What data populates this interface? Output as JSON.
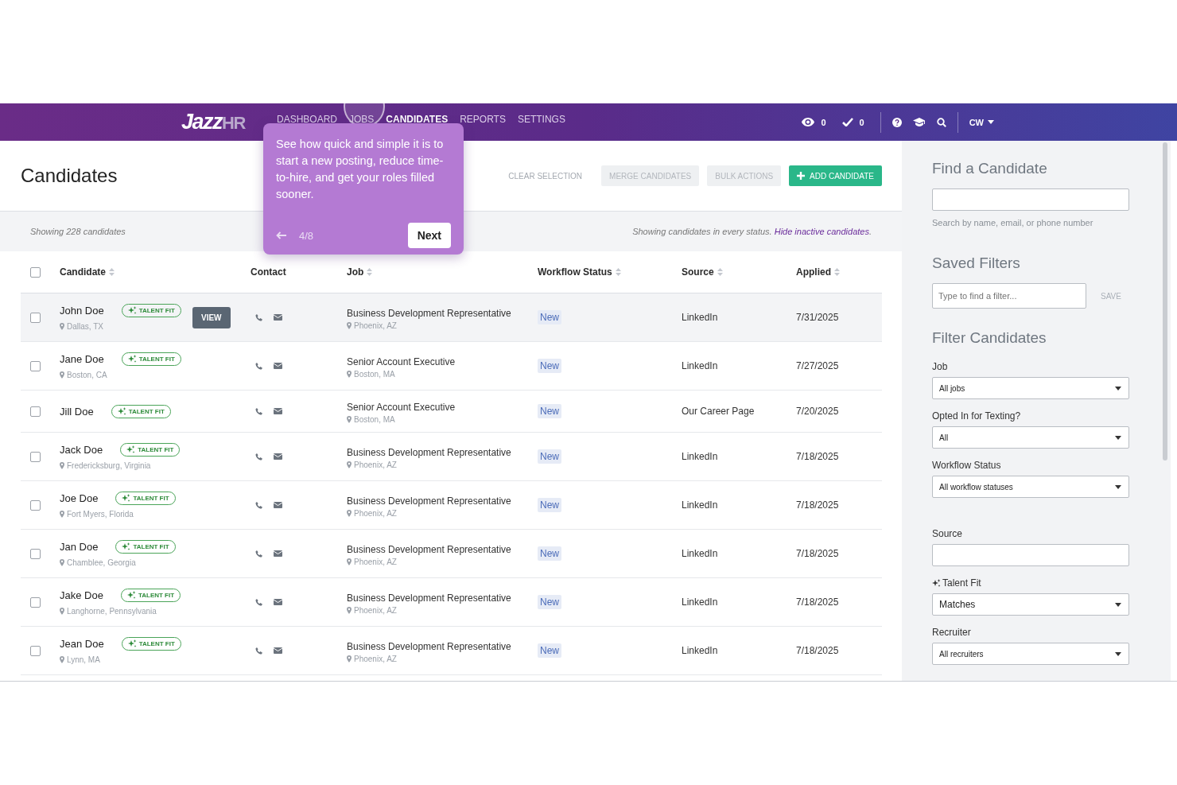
{
  "header": {
    "logo_main": "Jazz",
    "logo_accent": "HR",
    "nav": [
      {
        "label": "DASHBOARD",
        "selected": false
      },
      {
        "label": "JOBS",
        "selected": false
      },
      {
        "label": "CANDIDATES",
        "selected": true
      },
      {
        "label": "REPORTS",
        "selected": false
      },
      {
        "label": "SETTINGS",
        "selected": false
      }
    ],
    "stats": [
      {
        "kind": "views",
        "value": "0"
      },
      {
        "kind": "checks",
        "value": "0"
      }
    ],
    "user": "CW"
  },
  "tour": {
    "text": "See how quick and simple it is to start a new posting, reduce time-to-hire, and get your roles filled sooner.",
    "step": "4/8",
    "next": "Next"
  },
  "page": {
    "title": "Candidates",
    "actions": [
      {
        "label": "CLEAR SELECTION",
        "kind": "link"
      },
      {
        "label": "MERGE CANDIDATES",
        "kind": "disabled"
      },
      {
        "label": "BULK ACTIONS",
        "kind": "disabled"
      },
      {
        "label": "ADD CANDIDATE",
        "kind": "primary"
      }
    ]
  },
  "summary": {
    "count_text": "Showing 228 candidates",
    "status_text": "Showing candidates in every status.",
    "link": "Hide inactive candidates",
    "after": "."
  },
  "table": {
    "all_checked": false,
    "columns": [
      {
        "label": "Candidate",
        "sortable": true
      },
      {
        "label": "Contact",
        "sortable": false
      },
      {
        "label": "Job",
        "sortable": true
      },
      {
        "label": "Workflow Status",
        "sortable": true
      },
      {
        "label": "Source",
        "sortable": true
      },
      {
        "label": "Applied",
        "sortable": true
      }
    ],
    "rows": [
      {
        "name": "John Doe",
        "badge": "TALENT FIT",
        "location": "Dallas, TX",
        "hovered": true,
        "action": "VIEW",
        "job": "Business Development Representative",
        "job_location": "Phoenix, AZ",
        "status": "New",
        "source": "LinkedIn",
        "applied": "7/31/2025",
        "checked": false
      },
      {
        "name": "Jane Doe",
        "badge": "TALENT FIT",
        "location": "Boston, CA",
        "hovered": false,
        "job": "Senior Account Executive",
        "job_location": "Boston, MA",
        "status": "New",
        "source": "LinkedIn",
        "applied": "7/27/2025",
        "checked": false
      },
      {
        "name": "Jill Doe",
        "badge": "TALENT FIT",
        "hovered": false,
        "job": "Senior Account Executive",
        "job_location": "Boston, MA",
        "status": "New",
        "source": "Our Career Page",
        "applied": "7/20/2025",
        "checked": false
      },
      {
        "name": "Jack Doe",
        "badge": "TALENT FIT",
        "location": "Fredericksburg, Virginia",
        "hovered": false,
        "job": "Business Development Representative",
        "job_location": "Phoenix, AZ",
        "status": "New",
        "source": "LinkedIn",
        "applied": "7/18/2025",
        "checked": false
      },
      {
        "name": "Joe Doe",
        "badge": "TALENT FIT",
        "location": "Fort Myers, Florida",
        "hovered": false,
        "job": "Business Development Representative",
        "job_location": "Phoenix, AZ",
        "status": "New",
        "source": "LinkedIn",
        "applied": "7/18/2025",
        "checked": false
      },
      {
        "name": "Jan Doe",
        "badge": "TALENT FIT",
        "location": "Chamblee, Georgia",
        "hovered": false,
        "job": "Business Development Representative",
        "job_location": "Phoenix, AZ",
        "status": "New",
        "source": "LinkedIn",
        "applied": "7/18/2025",
        "checked": false
      },
      {
        "name": "Jake Doe",
        "badge": "TALENT FIT",
        "location": "Langhorne, Pennsylvania",
        "hovered": false,
        "job": "Business Development Representative",
        "job_location": "Phoenix, AZ",
        "status": "New",
        "source": "LinkedIn",
        "applied": "7/18/2025",
        "checked": false
      },
      {
        "name": "Jean Doe",
        "badge": "TALENT FIT",
        "location": "Lynn, MA",
        "hovered": false,
        "job": "Business Development Representative",
        "job_location": "Phoenix, AZ",
        "status": "New",
        "source": "LinkedIn",
        "applied": "7/18/2025",
        "checked": false
      }
    ]
  },
  "sidebar": {
    "find_title": "Find a Candidate",
    "find_hint": "Search by name, email, or phone number",
    "saved_title": "Saved Filters",
    "saved_placeholder": "Type to find a filter...",
    "save": "SAVE",
    "filter_title": "Filter Candidates",
    "filters": [
      {
        "label": "Job",
        "kind": "select",
        "value": "All jobs"
      },
      {
        "label": "Opted In for Texting?",
        "kind": "select",
        "value": "All"
      },
      {
        "label": "Workflow Status",
        "kind": "select",
        "value": "All workflow statuses"
      },
      {
        "label": "Source",
        "kind": "text"
      },
      {
        "label": "Talent Fit",
        "kind": "select",
        "value": "Matches",
        "sparkle": true
      },
      {
        "label": "Recruiter",
        "kind": "select",
        "value": "All recruiters"
      }
    ]
  }
}
